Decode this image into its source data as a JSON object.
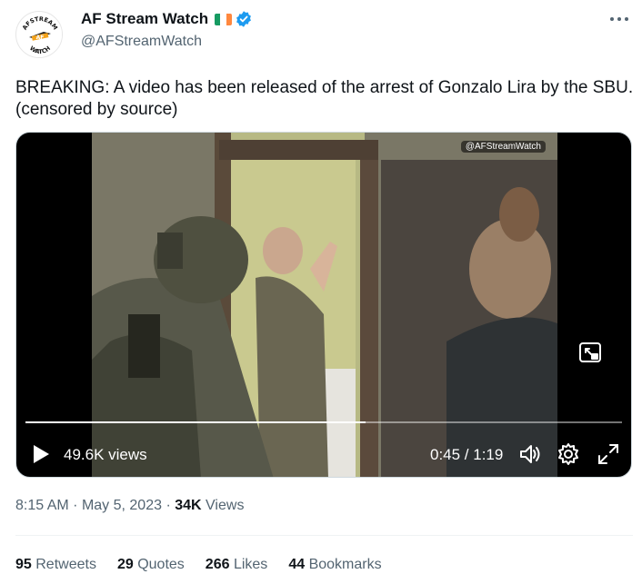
{
  "author": {
    "display_name": "AF Stream Watch",
    "handle": "@AFStreamWatch",
    "verified": true,
    "flag": [
      "#169b62",
      "#ffffff",
      "#ff883e"
    ],
    "avatar_text_top": "AFSTREAM",
    "avatar_text_bottom": "WATCH",
    "avatar_center": "AF"
  },
  "icons": {
    "more": "more-horizontal-icon",
    "verified": "verified-badge-icon",
    "play": "play-icon",
    "volume": "volume-icon",
    "settings": "gear-icon",
    "fullscreen": "expand-icon",
    "pip": "picture-in-picture-icon"
  },
  "tweet": {
    "text": "BREAKING: A video has been released of the arrest of Gonzalo Lira by the SBU. (censored by source)"
  },
  "video": {
    "watermark": "@AFStreamWatch",
    "views": "49.6K views",
    "time": "0:45 / 1:19",
    "progress": 0.57
  },
  "meta": {
    "time": "8:15 AM",
    "date": "May 5, 2023",
    "views_count": "34K",
    "views_label": "Views"
  },
  "stats": [
    {
      "count": "95",
      "label": "Retweets"
    },
    {
      "count": "29",
      "label": "Quotes"
    },
    {
      "count": "266",
      "label": "Likes"
    },
    {
      "count": "44",
      "label": "Bookmarks"
    }
  ],
  "colors": {
    "text_primary": "#0f1419",
    "text_secondary": "#536471",
    "verified_blue": "#1d9bf0"
  }
}
